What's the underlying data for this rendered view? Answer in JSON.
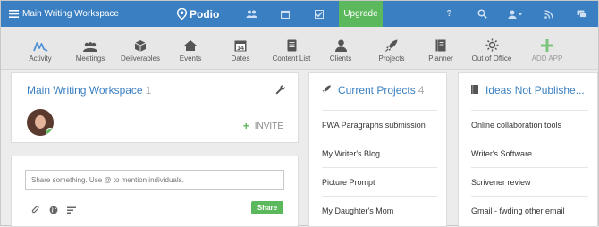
{
  "topbar": {
    "workspace_title": "Main Writing Workspace",
    "logo_text": "Podio",
    "upgrade_label": "Upgrade",
    "help_label": "?"
  },
  "apps": [
    {
      "label": "Activity",
      "icon": "activity-icon"
    },
    {
      "label": "Meetings",
      "icon": "meetings-icon"
    },
    {
      "label": "Deliverables",
      "icon": "deliverables-icon"
    },
    {
      "label": "Events",
      "icon": "events-icon"
    },
    {
      "label": "Dates",
      "icon": "dates-icon"
    },
    {
      "label": "Content List",
      "icon": "content-list-icon"
    },
    {
      "label": "Clients",
      "icon": "clients-icon"
    },
    {
      "label": "Projects",
      "icon": "projects-icon"
    },
    {
      "label": "Planner",
      "icon": "planner-icon"
    },
    {
      "label": "Out of Office",
      "icon": "out-of-office-icon"
    },
    {
      "label": "ADD APP",
      "icon": "add-app-icon"
    }
  ],
  "workspace_card": {
    "title": "Main Writing Workspace",
    "member_count": "1",
    "invite_label": "INVITE"
  },
  "share_card": {
    "placeholder": "Share something. Use @ to mention individuals.",
    "share_label": "Share"
  },
  "projects": {
    "title": "Current Projects",
    "count": "4",
    "items": [
      "FWA Paragraphs submission",
      "My Writer's Blog",
      "Picture Prompt",
      "My Daughter's Mom"
    ]
  },
  "ideas": {
    "title": "Ideas Not Publishe...",
    "items": [
      "Online collaboration tools",
      "Writer's Software",
      "Scrivener review",
      "Gmail - fwding other email"
    ]
  },
  "colors": {
    "topbar": "#3a7fc1",
    "upgrade": "#5cb85c",
    "accent": "#3a7fc1"
  }
}
